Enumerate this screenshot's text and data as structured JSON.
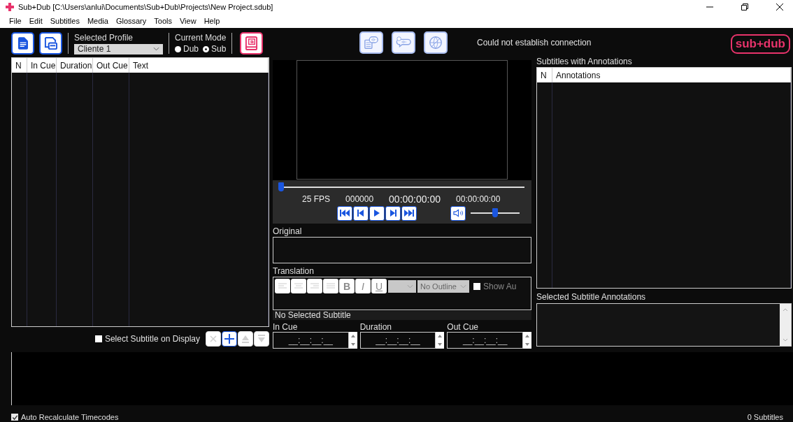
{
  "window": {
    "title": "Sub+Dub [C:\\Users\\anlui\\Documents\\Sub+Dub\\Projects\\New Project.sdub]"
  },
  "menu": [
    "File",
    "Edit",
    "Subtitles",
    "Media",
    "Glossary",
    "Tools",
    "View",
    "Help"
  ],
  "toolbar": {
    "profile_label": "Selected Profile",
    "profile_value": "Cliente 1",
    "mode_label": "Current Mode",
    "modes": [
      {
        "label": "Dub",
        "selected": false
      },
      {
        "label": "Sub",
        "selected": true
      }
    ]
  },
  "connection_status": "Could not establish connection",
  "logo": "sub+dub",
  "subtitle_table": {
    "columns": [
      "N",
      "In Cue",
      "Duration",
      "Out Cue",
      "Text"
    ]
  },
  "select_on_display": {
    "label": "Select Subtitle on Display",
    "checked": false
  },
  "list_buttons": [
    {
      "kind": "delete",
      "disabled": true
    },
    {
      "kind": "add",
      "disabled": false
    },
    {
      "kind": "up",
      "disabled": true
    },
    {
      "kind": "down",
      "disabled": true
    }
  ],
  "player": {
    "position": {
      "level": 0
    },
    "fps": "25 FPS",
    "frame": "000000",
    "timecode": "00:00:00:00",
    "duration": "00:00:00:00",
    "volume": {
      "level": 0.5
    }
  },
  "original": {
    "label": "Original"
  },
  "translation": {
    "label": "Translation",
    "format_buttons": [
      {
        "kind": "align-left"
      },
      {
        "kind": "align-center"
      },
      {
        "kind": "align-right"
      },
      {
        "kind": "justify"
      },
      {
        "kind": "bold",
        "label": "B"
      },
      {
        "kind": "italic",
        "label": "I"
      },
      {
        "kind": "underline",
        "label": "U"
      }
    ],
    "outline": "No Outline",
    "show_label": "Show Au",
    "show_checked": false
  },
  "selection_status": "No Selected Subtitle",
  "timecodes": [
    {
      "label": "In Cue",
      "value": "__:__:__:__"
    },
    {
      "label": "Duration",
      "value": "__:__:__:__"
    },
    {
      "label": "Out Cue",
      "value": "__:__:__:__"
    }
  ],
  "annotations_table": {
    "title": "Subtitles with Annotations",
    "columns": [
      "N",
      "Annotations"
    ]
  },
  "selected_annotations": {
    "label": "Selected Subtitle Annotations"
  },
  "status_bar": {
    "auto_recalc": {
      "label": "Auto Recalculate Timecodes",
      "checked": true
    },
    "count": "0 Subtitles"
  }
}
